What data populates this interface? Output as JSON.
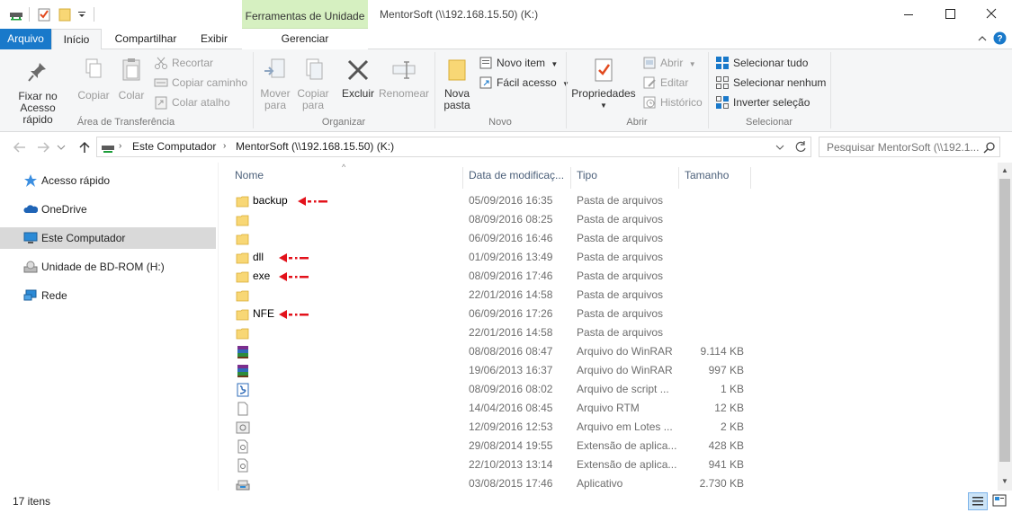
{
  "titlebar": {
    "context_tab": "Ferramentas de Unidade",
    "title": "MentorSoft (\\\\192.168.15.50) (K:)"
  },
  "tabs": {
    "arquivo": "Arquivo",
    "inicio": "Início",
    "compartilhar": "Compartilhar",
    "exibir": "Exibir",
    "gerenciar": "Gerenciar"
  },
  "ribbon": {
    "clipboard": {
      "group": "Área de Transferência",
      "pin": "Fixar no\nAcesso rápido",
      "copy": "Copiar",
      "paste": "Colar",
      "cut": "Recortar",
      "copy_path": "Copiar caminho",
      "paste_shortcut": "Colar atalho"
    },
    "organize": {
      "group": "Organizar",
      "move_to": "Mover\npara",
      "copy_to": "Copiar\npara",
      "delete": "Excluir",
      "rename": "Renomear"
    },
    "new": {
      "group": "Novo",
      "new_folder": "Nova\npasta",
      "new_item": "Novo item",
      "easy_access": "Fácil acesso"
    },
    "open": {
      "group": "Abrir",
      "properties": "Propriedades",
      "open": "Abrir",
      "edit": "Editar",
      "history": "Histórico"
    },
    "select": {
      "group": "Selecionar",
      "select_all": "Selecionar tudo",
      "select_none": "Selecionar nenhum",
      "invert": "Inverter seleção"
    }
  },
  "address": {
    "crumbs": [
      "Este Computador",
      "MentorSoft (\\\\192.168.15.50) (K:)"
    ],
    "search_placeholder": "Pesquisar MentorSoft (\\\\192.1..."
  },
  "nav": [
    {
      "label": "Acesso rápido",
      "icon": "star-icon"
    },
    {
      "label": "OneDrive",
      "icon": "cloud-icon"
    },
    {
      "label": "Este Computador",
      "icon": "computer-icon"
    },
    {
      "label": "Unidade de BD-ROM (H:)",
      "icon": "disc-drive-icon"
    },
    {
      "label": "Rede",
      "icon": "network-icon"
    }
  ],
  "columns": {
    "name": "Nome",
    "date": "Data de modificaç...",
    "type": "Tipo",
    "size": "Tamanho"
  },
  "files": [
    {
      "name": "backup",
      "date": "05/09/2016 16:35",
      "type": "Pasta de arquivos",
      "size": "",
      "icon": "folder",
      "marked": true
    },
    {
      "name": "",
      "date": "08/09/2016 08:25",
      "type": "Pasta de arquivos",
      "size": "",
      "icon": "folder",
      "marked": false
    },
    {
      "name": "",
      "date": "06/09/2016 16:46",
      "type": "Pasta de arquivos",
      "size": "",
      "icon": "folder",
      "marked": false
    },
    {
      "name": "dll",
      "date": "01/09/2016 13:49",
      "type": "Pasta de arquivos",
      "size": "",
      "icon": "folder",
      "marked": true
    },
    {
      "name": "exe",
      "date": "08/09/2016 17:46",
      "type": "Pasta de arquivos",
      "size": "",
      "icon": "folder",
      "marked": true
    },
    {
      "name": "",
      "date": "22/01/2016 14:58",
      "type": "Pasta de arquivos",
      "size": "",
      "icon": "folder",
      "marked": false
    },
    {
      "name": "NFE",
      "date": "06/09/2016 17:26",
      "type": "Pasta de arquivos",
      "size": "",
      "icon": "folder",
      "marked": true
    },
    {
      "name": "",
      "date": "22/01/2016 14:58",
      "type": "Pasta de arquivos",
      "size": "",
      "icon": "folder",
      "marked": false
    },
    {
      "name": "",
      "date": "08/08/2016 08:47",
      "type": "Arquivo do WinRAR",
      "size": "9.114 KB",
      "icon": "winrar",
      "marked": false
    },
    {
      "name": "",
      "date": "19/06/2013 16:37",
      "type": "Arquivo do WinRAR",
      "size": "997 KB",
      "icon": "winrar",
      "marked": false
    },
    {
      "name": "",
      "date": "08/09/2016 08:02",
      "type": "Arquivo de script ...",
      "size": "1 KB",
      "icon": "script",
      "marked": false
    },
    {
      "name": "",
      "date": "14/04/2016 08:45",
      "type": "Arquivo RTM",
      "size": "12 KB",
      "icon": "blank",
      "marked": false
    },
    {
      "name": "",
      "date": "12/09/2016 12:53",
      "type": "Arquivo em Lotes ...",
      "size": "2 KB",
      "icon": "batch",
      "marked": false
    },
    {
      "name": "",
      "date": "29/08/2014 19:55",
      "type": "Extensão de aplica...",
      "size": "428 KB",
      "icon": "dll",
      "marked": false
    },
    {
      "name": "",
      "date": "22/10/2013 13:14",
      "type": "Extensão de aplica...",
      "size": "941 KB",
      "icon": "dll",
      "marked": false
    },
    {
      "name": "",
      "date": "03/08/2015 17:46",
      "type": "Aplicativo",
      "size": "2.730 KB",
      "icon": "app",
      "marked": false
    }
  ],
  "status": {
    "count": "17 itens"
  },
  "colors": {
    "accent": "#1979ca",
    "context_tab": "#d6f0c1",
    "folder": "#f8d775",
    "marker": "#e3121b"
  }
}
